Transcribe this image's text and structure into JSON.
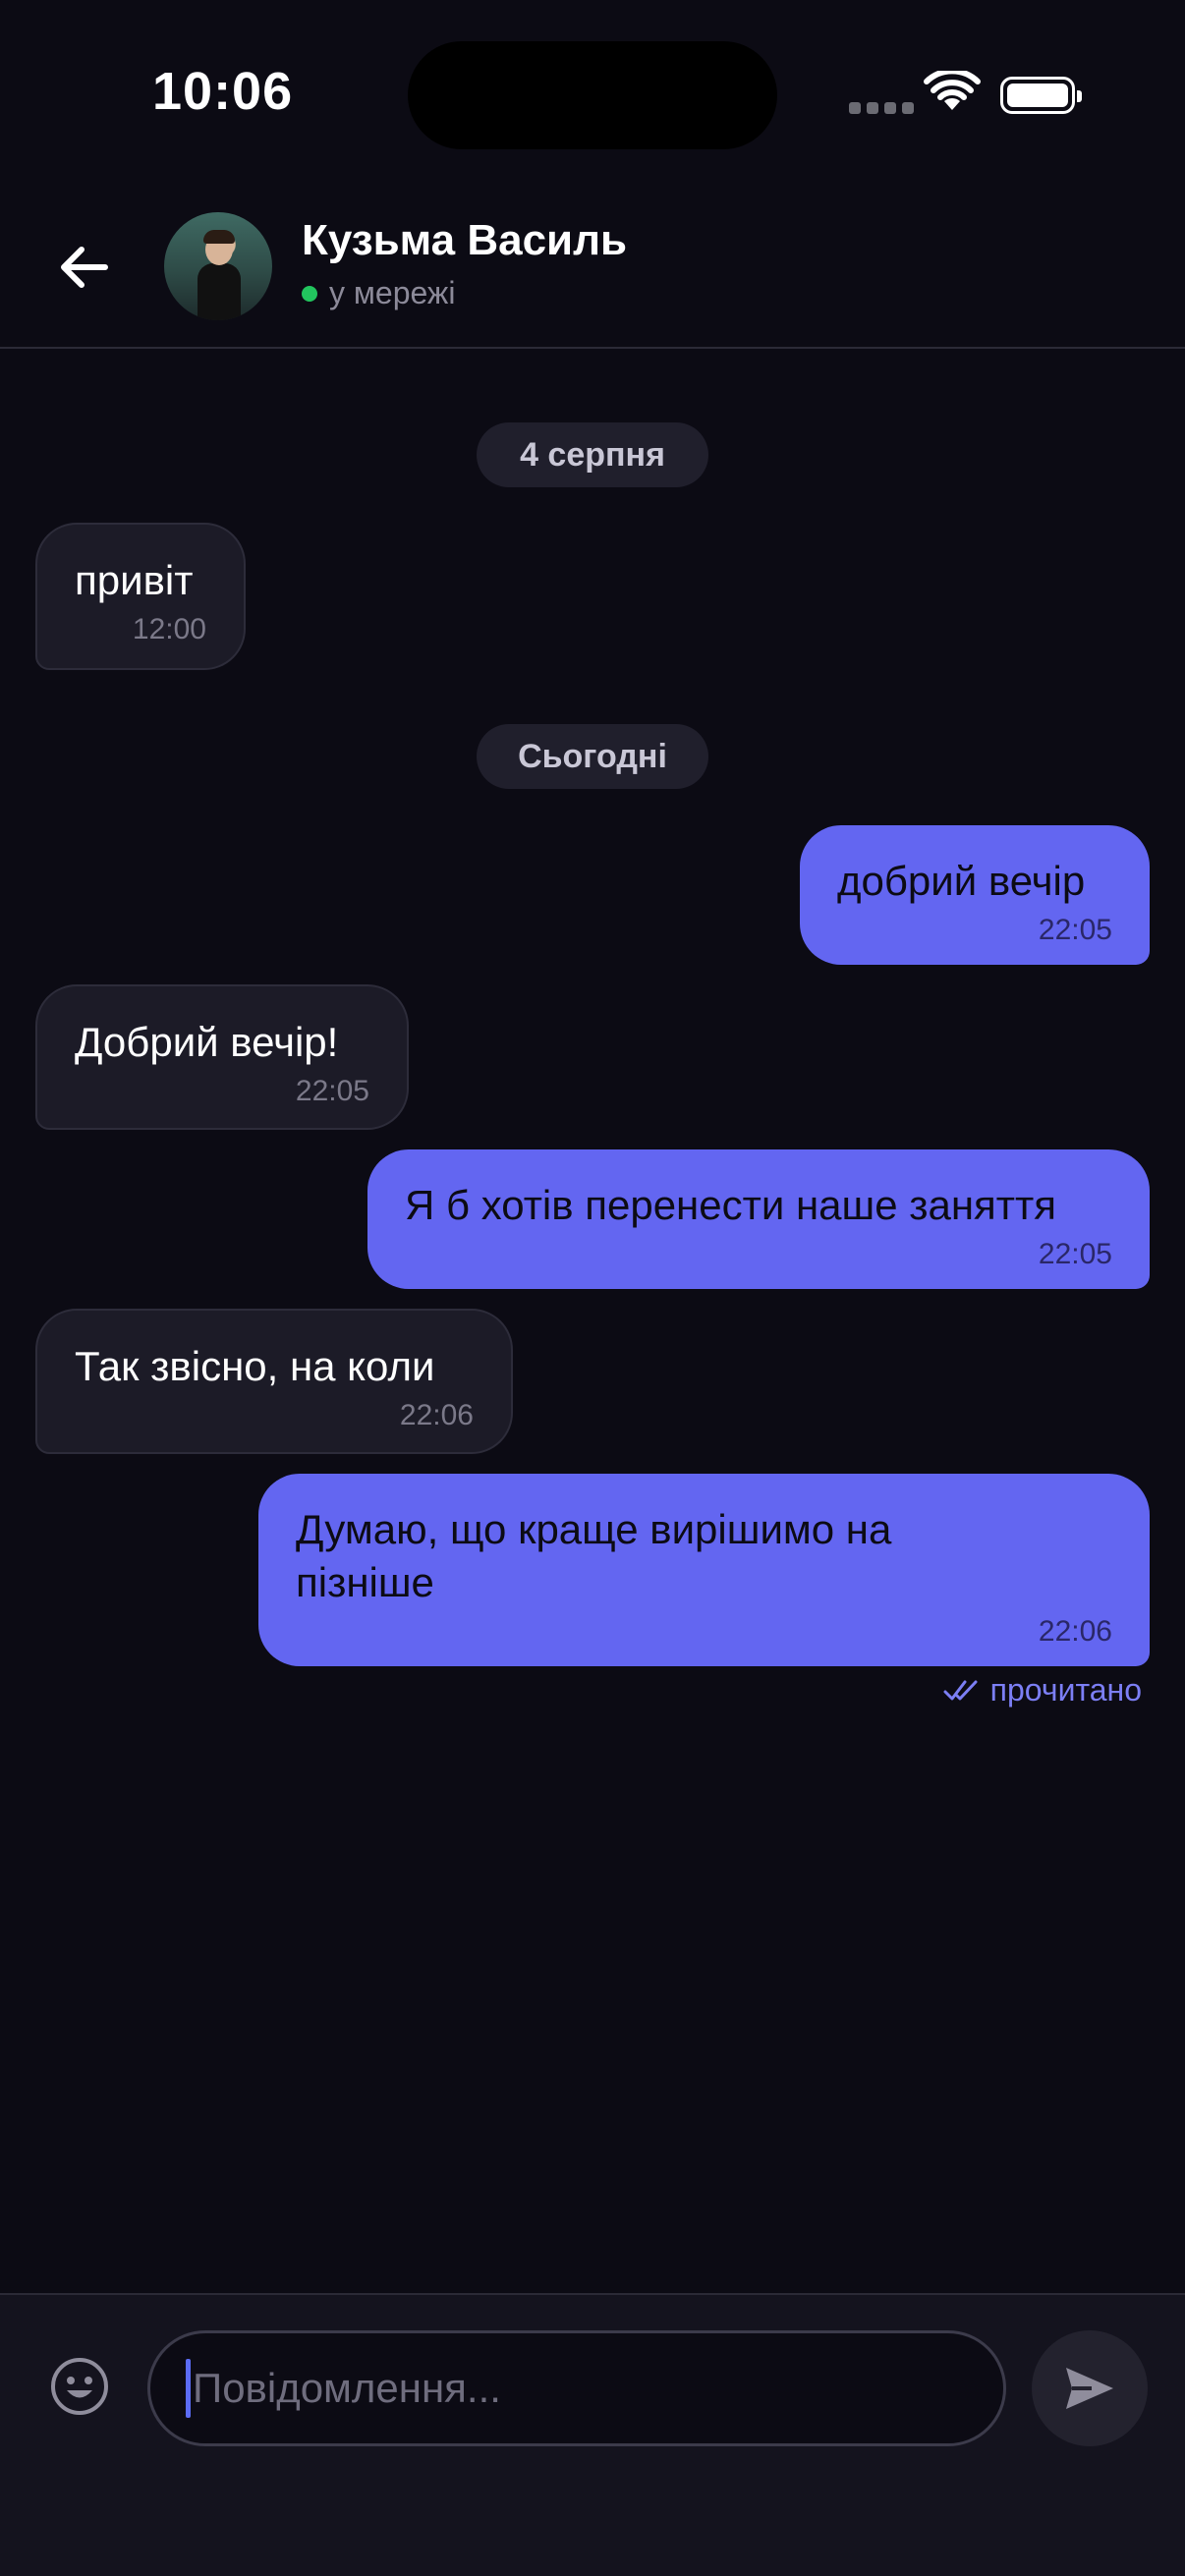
{
  "status_bar": {
    "time": "10:06"
  },
  "header": {
    "contact_name": "Кузьма Василь",
    "presence": "у мережі",
    "presence_color": "#22c55e"
  },
  "messages": [
    {
      "type": "date",
      "label": "4 серпня"
    },
    {
      "type": "incoming",
      "text": "привіт",
      "time": "12:00"
    },
    {
      "type": "date",
      "label": "Сьогодні"
    },
    {
      "type": "outgoing",
      "text": "добрий вечір",
      "time": "22:05"
    },
    {
      "type": "incoming",
      "text": "Добрий вечір!",
      "time": "22:05"
    },
    {
      "type": "outgoing",
      "text": "Я б хотів перенести наше заняття",
      "time": "22:05"
    },
    {
      "type": "incoming",
      "text": "Так звісно, на коли",
      "time": "22:06"
    },
    {
      "type": "outgoing",
      "text": "Думаю, що краще вирішимо на пізніше",
      "time": "22:06"
    }
  ],
  "read_status": "прочитано",
  "composer": {
    "placeholder": "Повідомлення..."
  },
  "colors": {
    "accent": "#6366f1",
    "background": "#0c0b14",
    "incoming_bubble": "#1c1b27"
  },
  "icons": [
    "back-arrow-icon",
    "wifi-icon",
    "battery-icon",
    "double-check-icon",
    "emoji-icon",
    "send-icon"
  ]
}
